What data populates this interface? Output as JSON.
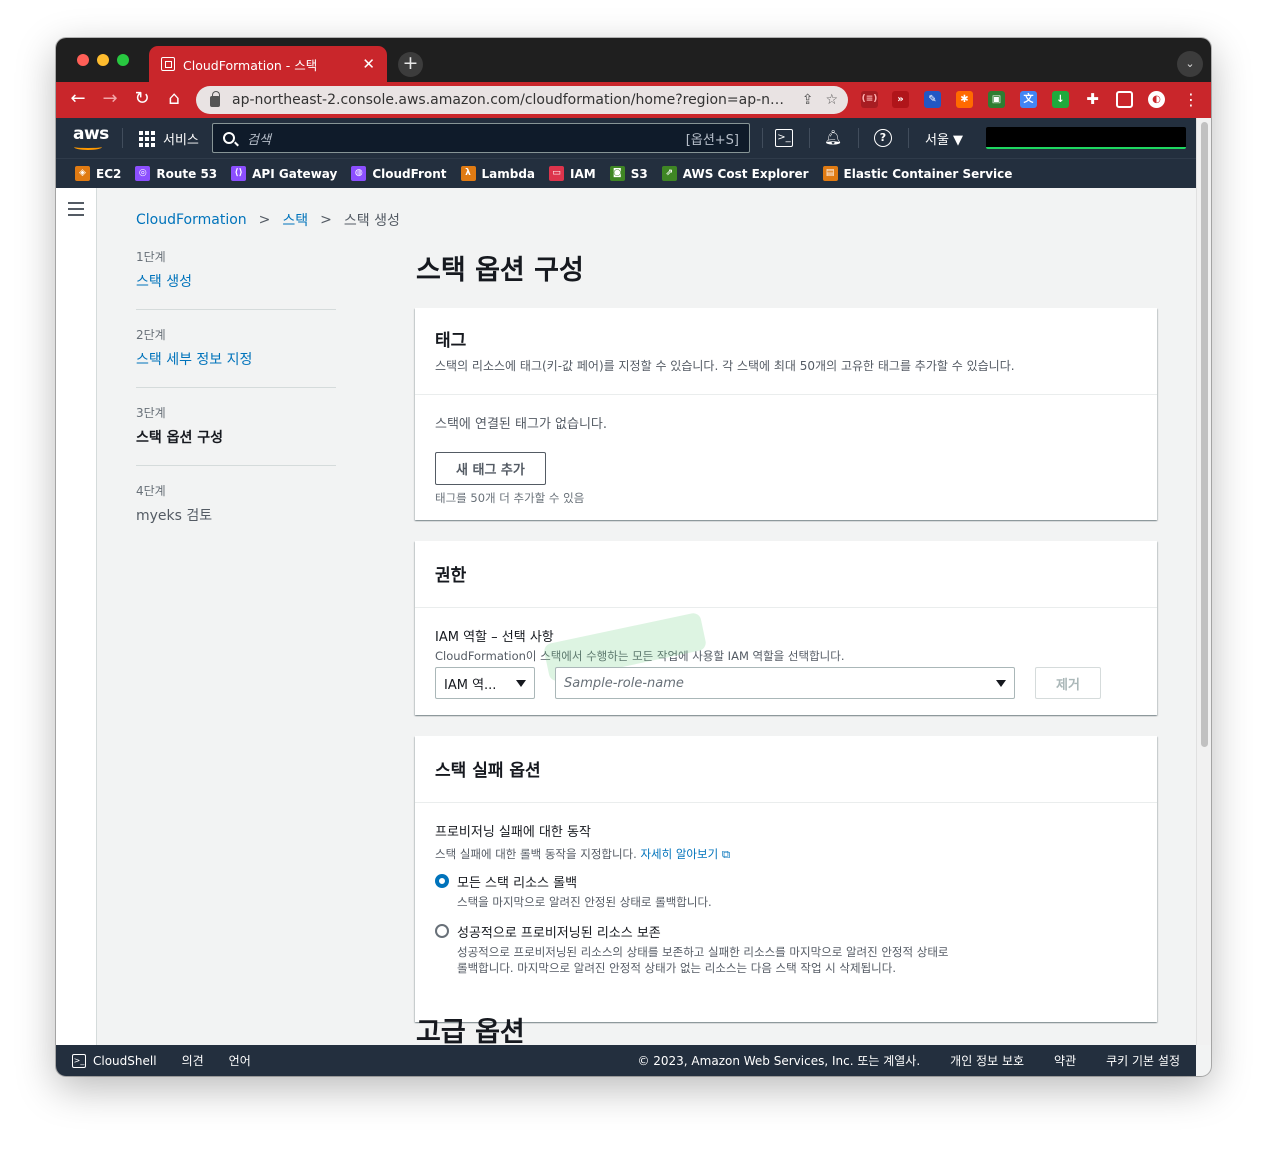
{
  "browser": {
    "tab_title": "CloudFormation - 스택",
    "tab_close": "✕",
    "new_tab": "+",
    "url": "ap-northeast-2.console.aws.amazon.com/cloudformation/home?region=ap-north..."
  },
  "aws_header": {
    "logo": "aws",
    "services_label": "서비스",
    "search_placeholder": "검색",
    "search_shortcut": "[옵션+S]",
    "region": "서울 ▼"
  },
  "favorites": [
    {
      "label": "EC2",
      "color": "#e07b13",
      "icon": "ec2-icon"
    },
    {
      "label": "Route 53",
      "color": "#8c4fff",
      "icon": "route53-icon"
    },
    {
      "label": "API Gateway",
      "color": "#8c4fff",
      "icon": "api-gateway-icon"
    },
    {
      "label": "CloudFront",
      "color": "#8c4fff",
      "icon": "cloudfront-icon"
    },
    {
      "label": "Lambda",
      "color": "#e07b13",
      "icon": "lambda-icon"
    },
    {
      "label": "IAM",
      "color": "#dd344c",
      "icon": "iam-icon"
    },
    {
      "label": "S3",
      "color": "#3f8624",
      "icon": "s3-icon"
    },
    {
      "label": "AWS Cost Explorer",
      "color": "#3f8624",
      "icon": "cost-explorer-icon"
    },
    {
      "label": "Elastic Container Service",
      "color": "#e07b13",
      "icon": "ecs-icon"
    }
  ],
  "breadcrumb": {
    "root": "CloudFormation",
    "section": "스택",
    "current": "스택 생성"
  },
  "steps": [
    {
      "number": "1단계",
      "label": "스택 생성",
      "state": "link"
    },
    {
      "number": "2단계",
      "label": "스택 세부 정보 지정",
      "state": "link"
    },
    {
      "number": "3단계",
      "label": "스택 옵션 구성",
      "state": "active"
    },
    {
      "number": "4단계",
      "label": "myeks 검토",
      "state": "disabled"
    }
  ],
  "page_title": "스택 옵션 구성",
  "tags_panel": {
    "title": "태그",
    "description": "스택의 리소스에 태그(키-값 페어)를 지정할 수 있습니다. 각 스택에 최대 50개의 고유한 태그를 추가할 수 있습니다.",
    "empty_text": "스택에 연결된 태그가 없습니다.",
    "add_button": "새 태그 추가",
    "hint": "태그를 50개 더 추가할 수 있음"
  },
  "permissions_panel": {
    "title": "권한",
    "field_label": "IAM 역할 – 선택 사항",
    "field_desc": "CloudFormation이 스택에서 수행하는 모든 작업에 사용할 IAM 역할을 선택합니다.",
    "type_select": "IAM 역...",
    "role_placeholder": "Sample-role-name",
    "remove_button": "제거"
  },
  "failure_panel": {
    "title": "스택 실패 옵션",
    "field_label": "프로비저닝 실패에 대한 동작",
    "field_desc": "스택 실패에 대한 롤백 동작을 지정합니다.",
    "learn_more": "자세히 알아보기",
    "options": [
      {
        "title": "모든 스택 리소스 롤백",
        "desc": "스택을 마지막으로 알려진 안정된 상태로 롤백합니다.",
        "checked": true
      },
      {
        "title": "성공적으로 프로비저닝된 리소스 보존",
        "desc": "성공적으로 프로비저닝된 리소스의 상태를 보존하고 실패한 리소스를 마지막으로 알려진 안정적 상태로 롤백합니다. 마지막으로 알려진 안정적 상태가 없는 리소스는 다음 스택 작업 시 삭제됩니다.",
        "checked": false
      }
    ]
  },
  "advanced_title": "고급 옵션",
  "footer": {
    "cloudshell": "CloudShell",
    "feedback": "의견",
    "language": "언어",
    "copyright": "© 2023, Amazon Web Services, Inc. 또는 계열사.",
    "privacy": "개인 정보 보호",
    "terms": "약관",
    "cookies": "쿠키 기본 설정"
  }
}
